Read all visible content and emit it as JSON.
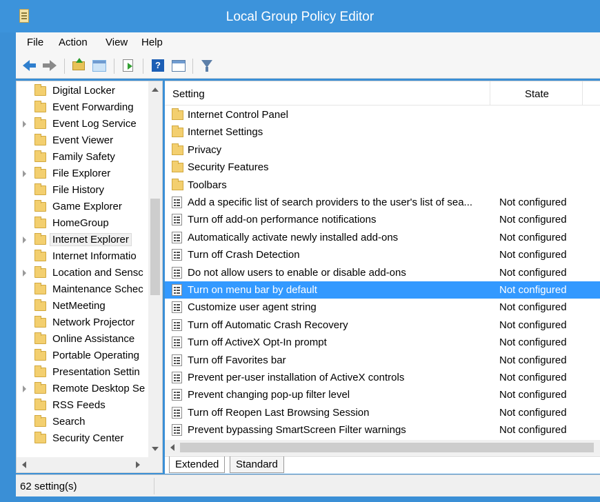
{
  "window": {
    "title": "Local Group Policy Editor"
  },
  "menu": [
    "File",
    "Action",
    "View",
    "Help"
  ],
  "toolbar": {
    "icons": [
      "back-icon",
      "forward-icon",
      "up-folder-icon",
      "show-hide-console-tree-icon",
      "export-list-icon",
      "help-icon",
      "show-hide-action-pane-icon",
      "filter-icon"
    ]
  },
  "tree": {
    "items": [
      {
        "label": "Digital Locker",
        "expandable": false
      },
      {
        "label": "Event Forwarding",
        "expandable": false
      },
      {
        "label": "Event Log Service",
        "expandable": true
      },
      {
        "label": "Event Viewer",
        "expandable": false
      },
      {
        "label": "Family Safety",
        "expandable": false
      },
      {
        "label": "File Explorer",
        "expandable": true
      },
      {
        "label": "File History",
        "expandable": false
      },
      {
        "label": "Game Explorer",
        "expandable": false
      },
      {
        "label": "HomeGroup",
        "expandable": false
      },
      {
        "label": "Internet Explorer",
        "expandable": true,
        "selected": true
      },
      {
        "label": "Internet Informatio",
        "expandable": false
      },
      {
        "label": "Location and Sensc",
        "expandable": true
      },
      {
        "label": "Maintenance Schec",
        "expandable": false
      },
      {
        "label": "NetMeeting",
        "expandable": false
      },
      {
        "label": "Network Projector",
        "expandable": false
      },
      {
        "label": "Online Assistance",
        "expandable": false
      },
      {
        "label": "Portable Operating",
        "expandable": false
      },
      {
        "label": "Presentation Settin",
        "expandable": false
      },
      {
        "label": "Remote Desktop Se",
        "expandable": true
      },
      {
        "label": "RSS Feeds",
        "expandable": false
      },
      {
        "label": "Search",
        "expandable": false
      },
      {
        "label": "Security Center",
        "expandable": false
      }
    ]
  },
  "list": {
    "columns": {
      "setting": "Setting",
      "state": "State"
    },
    "rows": [
      {
        "type": "folder",
        "name": "Internet Control Panel",
        "state": ""
      },
      {
        "type": "folder",
        "name": "Internet Settings",
        "state": ""
      },
      {
        "type": "folder",
        "name": "Privacy",
        "state": ""
      },
      {
        "type": "folder",
        "name": "Security Features",
        "state": ""
      },
      {
        "type": "folder",
        "name": "Toolbars",
        "state": ""
      },
      {
        "type": "setting",
        "name": "Add a specific list of search providers to the user's list of sea...",
        "state": "Not configured"
      },
      {
        "type": "setting",
        "name": "Turn off add-on performance notifications",
        "state": "Not configured"
      },
      {
        "type": "setting",
        "name": "Automatically activate newly installed add-ons",
        "state": "Not configured"
      },
      {
        "type": "setting",
        "name": "Turn off Crash Detection",
        "state": "Not configured"
      },
      {
        "type": "setting",
        "name": "Do not allow users to enable or disable add-ons",
        "state": "Not configured"
      },
      {
        "type": "setting",
        "name": "Turn on menu bar by default",
        "state": "Not configured",
        "selected": true
      },
      {
        "type": "setting",
        "name": "Customize user agent string",
        "state": "Not configured"
      },
      {
        "type": "setting",
        "name": "Turn off Automatic Crash Recovery",
        "state": "Not configured"
      },
      {
        "type": "setting",
        "name": "Turn off ActiveX Opt-In prompt",
        "state": "Not configured"
      },
      {
        "type": "setting",
        "name": "Turn off Favorites bar",
        "state": "Not configured"
      },
      {
        "type": "setting",
        "name": "Prevent per-user installation of ActiveX controls",
        "state": "Not configured"
      },
      {
        "type": "setting",
        "name": "Prevent changing pop-up filter level",
        "state": "Not configured"
      },
      {
        "type": "setting",
        "name": "Turn off Reopen Last Browsing Session",
        "state": "Not configured"
      },
      {
        "type": "setting",
        "name": "Prevent bypassing SmartScreen Filter warnings",
        "state": "Not configured"
      }
    ]
  },
  "tabs": [
    {
      "label": "Extended",
      "active": true
    },
    {
      "label": "Standard",
      "active": false
    }
  ],
  "status": {
    "text": "62 setting(s)"
  },
  "colors": {
    "title_bar": "#3c93db",
    "selection": "#3399ff"
  }
}
